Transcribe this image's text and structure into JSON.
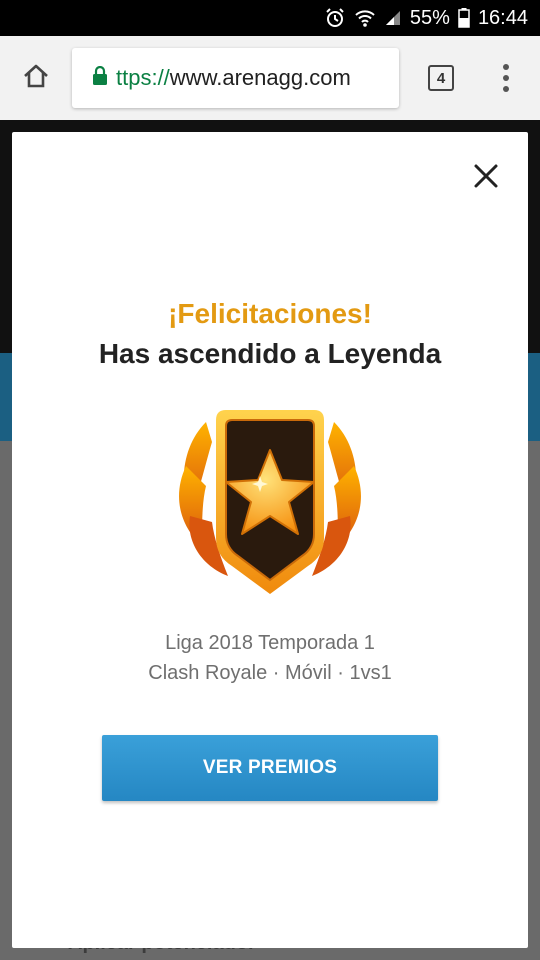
{
  "status_bar": {
    "battery": "55%",
    "time": "16:44"
  },
  "browser": {
    "url_scheme": "ttps://",
    "url_host": "www.arenagg.com",
    "tab_count": "4"
  },
  "background_page": {
    "partial_text": "Aplicar potenciador"
  },
  "modal": {
    "congrats": "¡Felicitaciones!",
    "subtitle": "Has ascendido a Leyenda",
    "league": "Liga 2018 Temporada 1",
    "meta": "Clash Royale · Móvil · 1vs1",
    "cta_label": "VER PREMIOS"
  },
  "colors": {
    "accent_orange": "#e39a12",
    "cta_blue": "#2f95d1",
    "url_green": "#0b8043"
  },
  "icons": {
    "home": "home-icon",
    "lock": "lock-icon",
    "tabs": "tabs-icon",
    "menu": "more-vert-icon",
    "close": "close-icon",
    "badge": "legend-rank-badge-icon"
  }
}
